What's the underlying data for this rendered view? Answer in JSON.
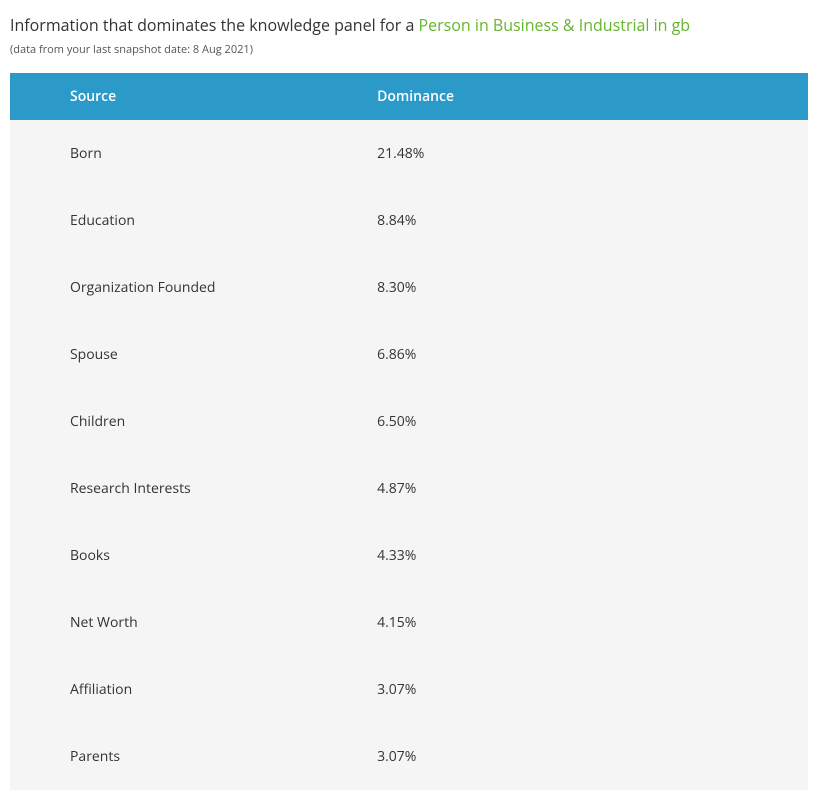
{
  "heading": {
    "prefix": "Information that dominates the knowledge panel for a ",
    "link_text": "Person in Business & Industrial in gb"
  },
  "subtitle": "(data from your last snapshot date: 8 Aug 2021)",
  "table": {
    "headers": {
      "source": "Source",
      "dominance": "Dominance"
    },
    "rows": [
      {
        "source": "Born",
        "dominance": "21.48%"
      },
      {
        "source": "Education",
        "dominance": "8.84%"
      },
      {
        "source": "Organization Founded",
        "dominance": "8.30%"
      },
      {
        "source": "Spouse",
        "dominance": "6.86%"
      },
      {
        "source": "Children",
        "dominance": "6.50%"
      },
      {
        "source": "Research Interests",
        "dominance": "4.87%"
      },
      {
        "source": "Books",
        "dominance": "4.33%"
      },
      {
        "source": "Net Worth",
        "dominance": "4.15%"
      },
      {
        "source": "Affiliation",
        "dominance": "3.07%"
      },
      {
        "source": "Parents",
        "dominance": "3.07%"
      }
    ]
  }
}
